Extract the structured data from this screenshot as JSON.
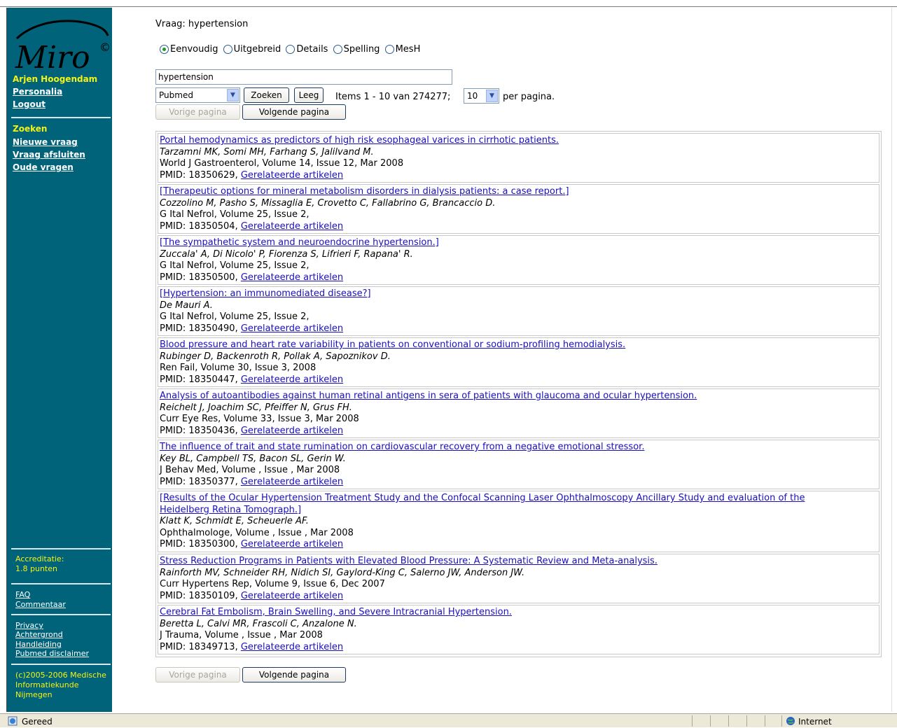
{
  "sidebar": {
    "logo_text": "Miro",
    "logo_mark": "©",
    "user_name": "Arjen Hoogendam",
    "personalia": "Personalia",
    "logout": "Logout",
    "section_title": "Zoeken",
    "nieuwe_vraag": "Nieuwe vraag",
    "vraag_afsluiten": "Vraag afsluiten",
    "oude_vragen": "Oude vragen",
    "accreditatie_label": "Accreditatie:",
    "accreditatie_value": "1.8 punten",
    "faq": "FAQ",
    "commentaar": "Commentaar",
    "privacy": "Privacy",
    "achtergrond": "Achtergrond",
    "handleiding": "Handleiding",
    "pubmed_disclaimer": "Pubmed disclaimer",
    "copyright_line1": "(c)2005-2006 Medische",
    "copyright_line2": "Informatiekunde",
    "copyright_line3": "Nijmegen"
  },
  "query_line": "Vraag: hypertension",
  "search_modes": [
    {
      "label": "Eenvoudig",
      "selected": true
    },
    {
      "label": "Uitgebreid",
      "selected": false
    },
    {
      "label": "Details",
      "selected": false
    },
    {
      "label": "Spelling",
      "selected": false
    },
    {
      "label": "MesH",
      "selected": false
    }
  ],
  "search": {
    "value": "hypertension",
    "database": "Pubmed",
    "search_button": "Zoeken",
    "clear_button": "Leeg",
    "items_text": "Items 1 - 10 van 274277;",
    "per_page_value": "10",
    "per_page_text": "per pagina."
  },
  "pager": {
    "prev": "Vorige pagina",
    "next": "Volgende pagina"
  },
  "results": [
    {
      "title": "Portal hemodynamics as predictors of high risk esophageal varices in cirrhotic patients.",
      "title2": "",
      "authors": "Tarzamni MK, Somi MH, Farhang S, Jalilvand M.",
      "source": "World J Gastroenterol, Volume 14, Issue 12, Mar 2008",
      "pmid": "PMID: 18350629,",
      "related": "Gerelateerde artikelen"
    },
    {
      "title": "[Therapeutic options for mineral metabolism disorders in dialysis patients: a case report.]",
      "title2": "",
      "authors": "Cozzolino M, Pasho S, Missaglia E, Crovetto C, Fallabrino G, Brancaccio D.",
      "source": "G Ital Nefrol, Volume 25, Issue 2,",
      "pmid": "PMID: 18350504,",
      "related": "Gerelateerde artikelen"
    },
    {
      "title": "[The sympathetic system and neuroendocrine hypertension.]",
      "title2": "",
      "authors": "Zuccala' A, Di Nicolo' P, Fiorenza S, Lifrieri F, Rapana' R.",
      "source": "G Ital Nefrol, Volume 25, Issue 2,",
      "pmid": "PMID: 18350500,",
      "related": "Gerelateerde artikelen"
    },
    {
      "title": "[Hypertension: an immunomediated disease?]",
      "title2": "",
      "authors": "De Mauri A.",
      "source": "G Ital Nefrol, Volume 25, Issue 2,",
      "pmid": "PMID: 18350490,",
      "related": "Gerelateerde artikelen"
    },
    {
      "title": "Blood pressure and heart rate variability in patients on conventional or sodium-profiling hemodialysis.",
      "title2": "",
      "authors": "Rubinger D, Backenroth R, Pollak A, Sapoznikov D.",
      "source": "Ren Fail, Volume 30, Issue 3, 2008",
      "pmid": "PMID: 18350447,",
      "related": "Gerelateerde artikelen"
    },
    {
      "title": "Analysis of autoantibodies against human retinal antigens in sera of patients with glaucoma and ocular hypertension.",
      "title2": "",
      "authors": "Reichelt J, Joachim SC, Pfeiffer N, Grus FH.",
      "source": "Curr Eye Res, Volume 33, Issue 3, Mar 2008",
      "pmid": "PMID: 18350436,",
      "related": "Gerelateerde artikelen"
    },
    {
      "title": "The influence of trait and state rumination on cardiovascular recovery from a negative emotional stressor.",
      "title2": "",
      "authors": "Key BL, Campbell TS, Bacon SL, Gerin W.",
      "source": "J Behav Med, Volume , Issue , Mar 2008",
      "pmid": "PMID: 18350377,",
      "related": "Gerelateerde artikelen"
    },
    {
      "title": "[Results of the Ocular Hypertension Treatment Study and the Confocal Scanning Laser Ophthalmoscopy Ancillary Study and evaluation of the",
      "title2": "Heidelberg Retina Tomograph.]",
      "authors": "Klatt K, Schmidt E, Scheuerle AF.",
      "source": "Ophthalmologe, Volume , Issue , Mar 2008",
      "pmid": "PMID: 18350300,",
      "related": "Gerelateerde artikelen"
    },
    {
      "title": "Stress Reduction Programs in Patients with Elevated Blood Pressure: A Systematic Review and Meta-analysis.",
      "title2": "",
      "authors": "Rainforth MV, Schneider RH, Nidich SI, Gaylord-King C, Salerno JW, Anderson JW.",
      "source": "Curr Hypertens Rep, Volume 9, Issue 6, Dec 2007",
      "pmid": "PMID: 18350109,",
      "related": "Gerelateerde artikelen"
    },
    {
      "title": "Cerebral Fat Embolism, Brain Swelling, and Severe Intracranial Hypertension.",
      "title2": "",
      "authors": "Beretta L, Calvi MR, Frascoli C, Anzalone N.",
      "source": "J Trauma, Volume , Issue , Mar 2008",
      "pmid": "PMID: 18349713,",
      "related": "Gerelateerde artikelen"
    }
  ],
  "statusbar": {
    "status": "Gereed",
    "zone": "Internet"
  },
  "colors": {
    "sidebar_bg": "#00637a",
    "sidebar_accent": "#f3f316",
    "link": "#1a0fbf"
  }
}
